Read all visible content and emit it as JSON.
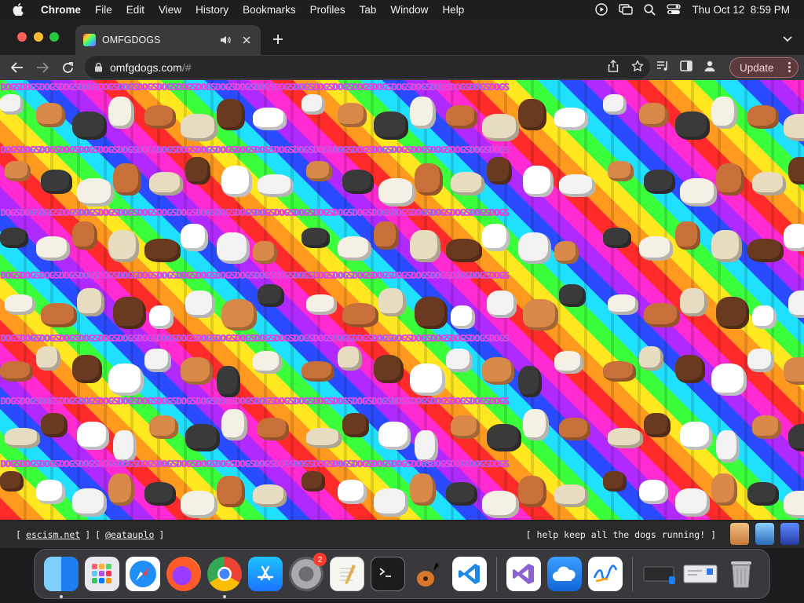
{
  "menubar": {
    "app_name": "Chrome",
    "items": [
      "File",
      "Edit",
      "View",
      "History",
      "Bookmarks",
      "Profiles",
      "Tab",
      "Window",
      "Help"
    ],
    "clock": "Thu Oct 12  8:59 PM"
  },
  "tab": {
    "title": "OMFGDOGS"
  },
  "toolbar": {
    "url_host": "omfgdogs.com",
    "url_path": "/#",
    "update_label": "Update"
  },
  "page": {
    "banner_text": "DOGSDOGSDOGSDOGSDOGSDOGSDOGSDOGSDOGSDOGSDOGSDOGSDOGSDOGSDOGSDOGSDOGSDOGSDOGSDOGSDOGSDOGSDOGSDOGSDOGSDOGS",
    "footer": {
      "open_bracket": "[",
      "close_bracket": "]",
      "link1": "escism.net",
      "link2": "@eatauplo",
      "help_text": "[ help keep all the dogs running! ]"
    }
  },
  "dock": {
    "apps": [
      "finder",
      "launchpad",
      "safari",
      "firefox",
      "chrome",
      "app-store",
      "system-settings",
      "textedit",
      "terminal",
      "garageband",
      "vscode",
      "visual-studio",
      "onedrive",
      "freeform",
      "screen-sharing",
      "network-utility",
      "trash"
    ],
    "settings_badge": "2"
  },
  "colors": {
    "menubar_bg": "#1e1e1e",
    "toolbar_bg": "#3a3a3c",
    "update_border": "#b06a6a"
  }
}
